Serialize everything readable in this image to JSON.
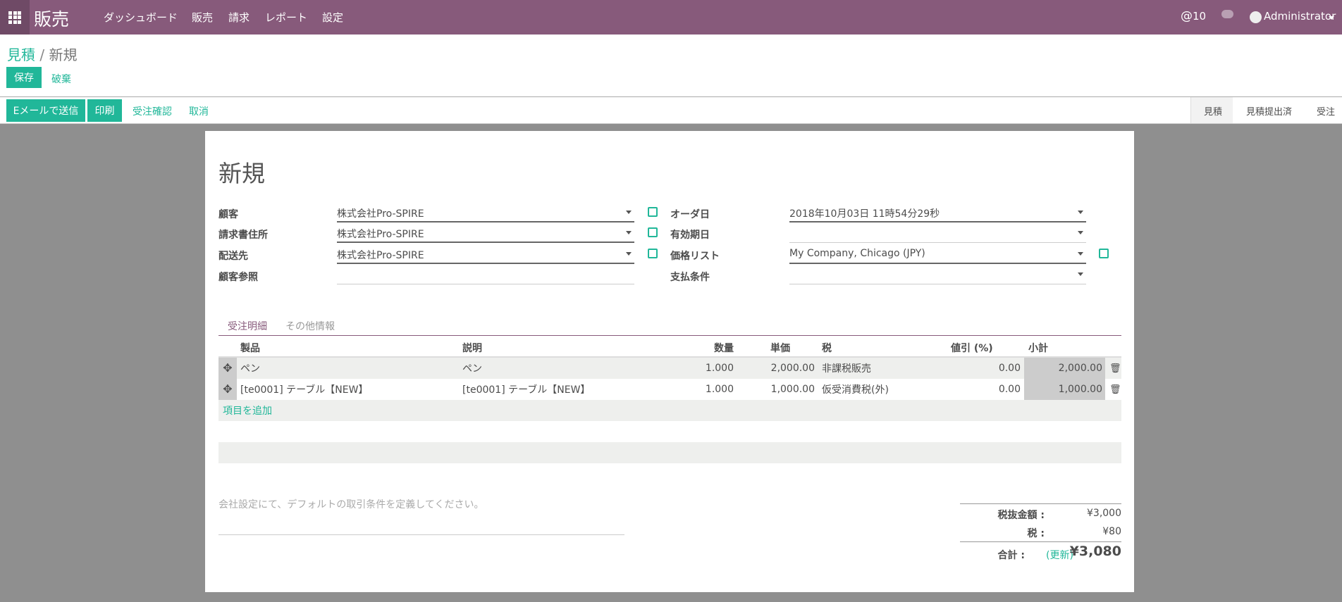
{
  "navbar": {
    "app": "販売",
    "menu": [
      "ダッシュボード",
      "販売",
      "請求",
      "レポート",
      "設定"
    ],
    "mentions": "10",
    "user": "Administrator",
    "color": "#875A7B"
  },
  "breadcrumb": {
    "parent": "見積",
    "current": "新規"
  },
  "buttons": {
    "save": "保存",
    "discard": "破棄",
    "send_email": "Eメールで送信",
    "print": "印刷",
    "confirm": "受注確認",
    "cancel": "取消"
  },
  "statusbar": [
    "見積",
    "見積提出済",
    "受注"
  ],
  "form": {
    "title": "新規",
    "left": [
      {
        "label": "顧客",
        "value": "株式会社Pro-SPIRE"
      },
      {
        "label": "請求書住所",
        "value": "株式会社Pro-SPIRE"
      },
      {
        "label": "配送先",
        "value": "株式会社Pro-SPIRE"
      },
      {
        "label": "顧客参照",
        "value": ""
      }
    ],
    "right": [
      {
        "label": "オーダ日",
        "value": "2018年10月03日 11時54分29秒"
      },
      {
        "label": "有効期日",
        "value": ""
      },
      {
        "label": "価格リスト",
        "value": "My Company, Chicago (JPY)"
      },
      {
        "label": "支払条件",
        "value": ""
      }
    ]
  },
  "tabs": [
    "受注明細",
    "その他情報"
  ],
  "table": {
    "headers": [
      "製品",
      "説明",
      "数量",
      "単価",
      "税",
      "値引 (%)",
      "小計"
    ],
    "rows": [
      [
        "ペン",
        "ペン",
        "1.000",
        "2,000.00",
        "非課税販売",
        "0.00",
        "2,000.00"
      ],
      [
        "[te0001] テーブル【NEW】",
        "[te0001] テーブル【NEW】",
        "1.000",
        "1,000.00",
        "仮受消費税(外)",
        "0.00",
        "1,000.00"
      ]
    ],
    "add": "項目を追加"
  },
  "note_placeholder": "会社設定にて、デフォルトの取引条件を定義してください。",
  "totals": {
    "untaxed_label": "税抜金額 :",
    "untaxed": "¥3,000",
    "tax_label": "税 :",
    "tax": "¥80",
    "total_label": "合計 :",
    "update": "(更新)",
    "total": "¥3,080"
  }
}
